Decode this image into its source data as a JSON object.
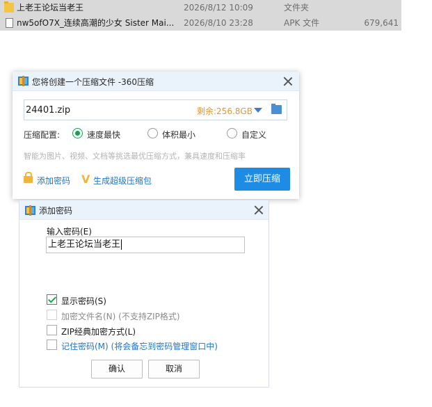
{
  "files": [
    {
      "name": "上老王论坛当老王",
      "date": "2026/8/12 10:09",
      "type": "文件夹",
      "size": "",
      "icon": "folder-icon",
      "selected": true
    },
    {
      "name": "nw5ofO7X_连续高潮的少女 Sister Mai...",
      "date": "2026/8/10 23:28",
      "type": "APK 文件",
      "size": "679,641",
      "icon": "file-icon",
      "selected": true
    }
  ],
  "compress_dialog": {
    "title": "您将创建一个压缩文件 -360压缩",
    "filename": "24401.zip",
    "free_space": "剩余:256.8GB",
    "config_label": "压缩配置:",
    "options": [
      {
        "label": "速度最快",
        "checked": true
      },
      {
        "label": "体积最小",
        "checked": false
      },
      {
        "label": "自定义",
        "checked": false
      }
    ],
    "hint": "智能为图片、视频、文档等挑选最优压缩方式，兼具速度和压缩率",
    "add_password_link": "添加密码",
    "super_package_link": "生成超级压缩包",
    "compress_button": "立即压缩",
    "accent_color": "#1e8be5",
    "link_color": "#2475c4",
    "free_space_color": "#e0963a"
  },
  "password_dialog": {
    "title": "添加密码",
    "input_label": "输入密码(E)",
    "password_value": "上老王论坛当老王",
    "checkboxes": [
      {
        "label": "显示密码(S)",
        "checked": true,
        "enabled": true
      },
      {
        "label": "加密文件名(N) (不支持ZIP格式)",
        "checked": false,
        "enabled": false
      },
      {
        "label": "ZIP经典加密方式(L)",
        "checked": false,
        "enabled": true
      },
      {
        "label": "记住密码(M) (将会备忘到密码管理窗口中)",
        "checked": false,
        "enabled": true,
        "link_style": true
      }
    ],
    "ok_button": "确认",
    "cancel_button": "取消",
    "check_color": "#1aa64c"
  }
}
